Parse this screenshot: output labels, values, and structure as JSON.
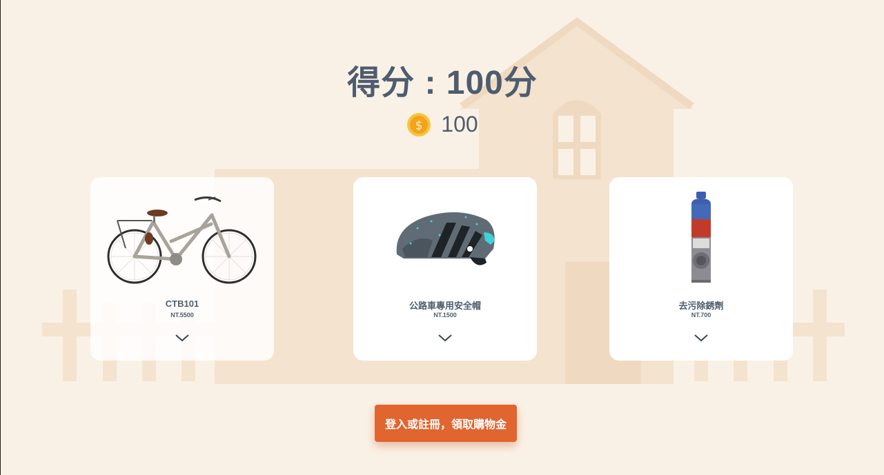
{
  "score": {
    "label": "得分 : 100分"
  },
  "coins": {
    "icon": "coin-icon",
    "value": "100"
  },
  "products": [
    {
      "name": "CTB101",
      "price": "NT.5500",
      "image": "bicycle-image"
    },
    {
      "name": "公路車專用安全帽",
      "price": "NT.1500",
      "image": "helmet-image"
    },
    {
      "name": "去污除銹劑",
      "price": "NT.700",
      "image": "rust-remover-spray-image"
    }
  ],
  "cta": {
    "label": "登入或註冊，領取購物金"
  },
  "colors": {
    "background": "#faf1e6",
    "house": "#f2dfc8",
    "text": "#4e5d6e",
    "accent": "#e0652f",
    "coin": "#f6b21b"
  }
}
